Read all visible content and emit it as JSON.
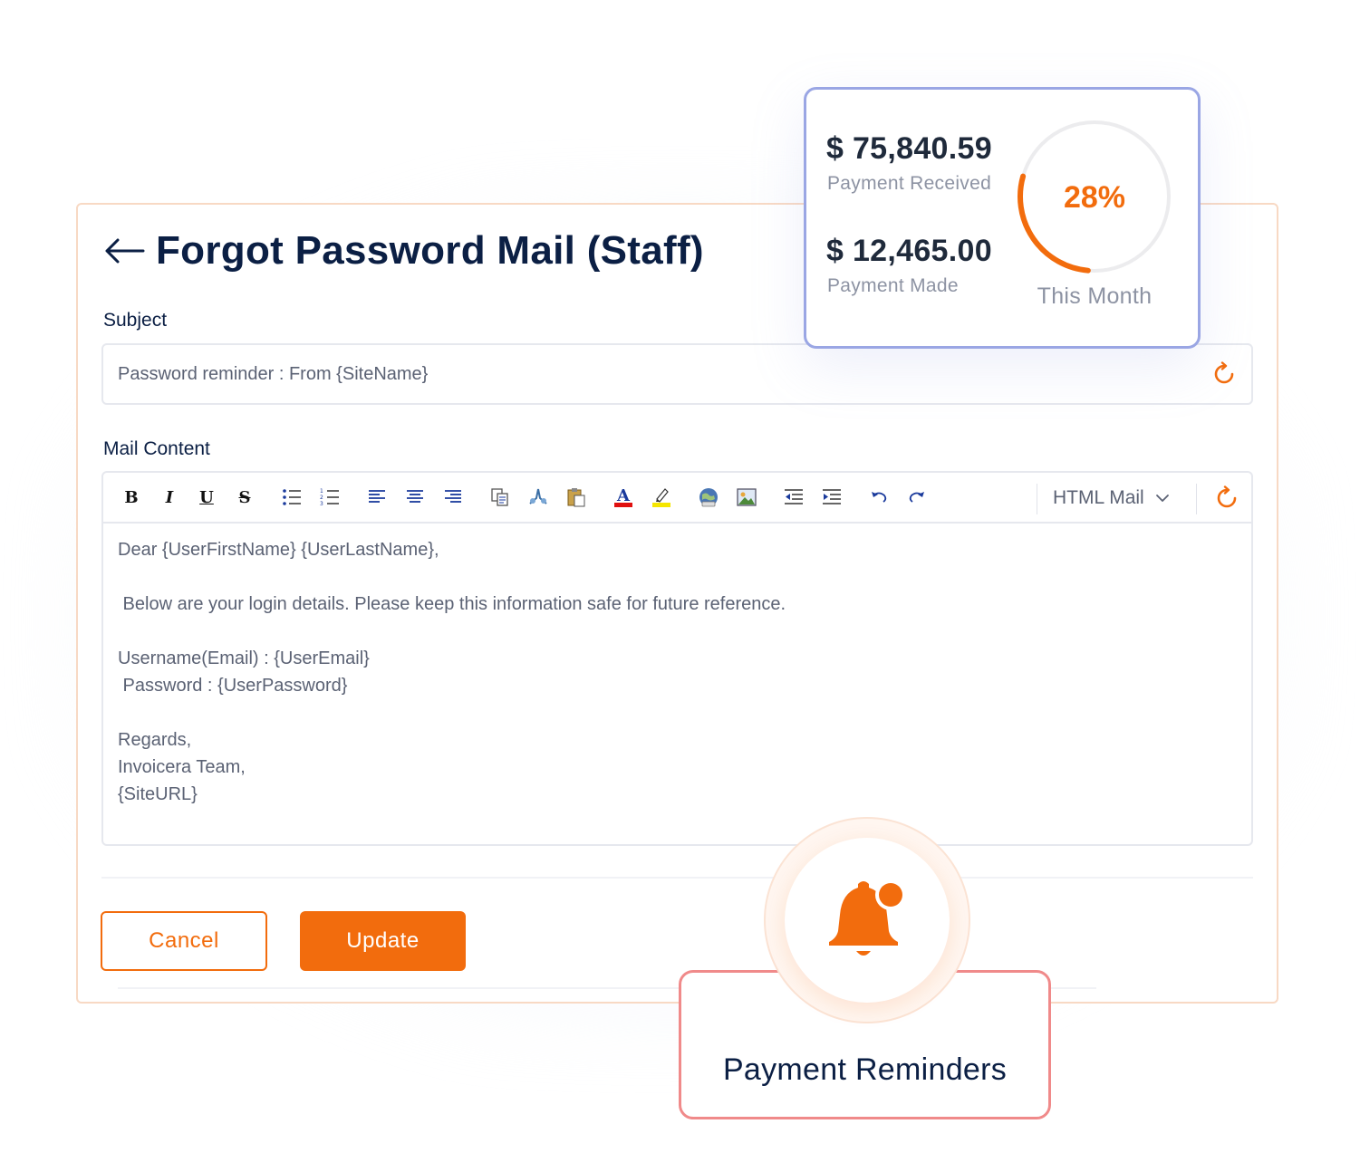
{
  "page": {
    "title": "Forgot Password Mail (Staff)"
  },
  "subject": {
    "label": "Subject",
    "value": "Password reminder : From {SiteName}"
  },
  "mail_content": {
    "label": "Mail Content",
    "mode": "HTML Mail",
    "body": "Dear {UserFirstName} {UserLastName},\n\n Below are your login details. Please keep this information safe for future reference.\n\nUsername(Email) : {UserEmail}\n Password : {UserPassword}\n\nRegards,\nInvoicera Team,\n{SiteURL}",
    "toolbar": [
      "bold-icon",
      "italic-icon",
      "underline-icon",
      "strikethrough-icon",
      "bullet-list-icon",
      "numbered-list-icon",
      "align-left-icon",
      "align-center-icon",
      "align-right-icon",
      "copy-icon",
      "cut-icon",
      "paste-icon",
      "font-color-icon",
      "highlight-icon",
      "link-globe-icon",
      "image-icon",
      "outdent-icon",
      "indent-icon",
      "undo-icon",
      "redo-icon"
    ]
  },
  "actions": {
    "cancel_label": "Cancel",
    "update_label": "Update"
  },
  "stats": {
    "received_amount": "$ 75,840.59",
    "received_label": "Payment Received",
    "made_amount": "$ 12,465.00",
    "made_label": "Payment Made",
    "percent": 28,
    "percent_label": "28%",
    "period_label": "This Month"
  },
  "reminder": {
    "label": "Payment Reminders"
  },
  "colors": {
    "accent": "#f26c0d",
    "title": "#0b1f44",
    "stats_border": "#9aa6e4",
    "reminder_border": "#f08a8a"
  }
}
